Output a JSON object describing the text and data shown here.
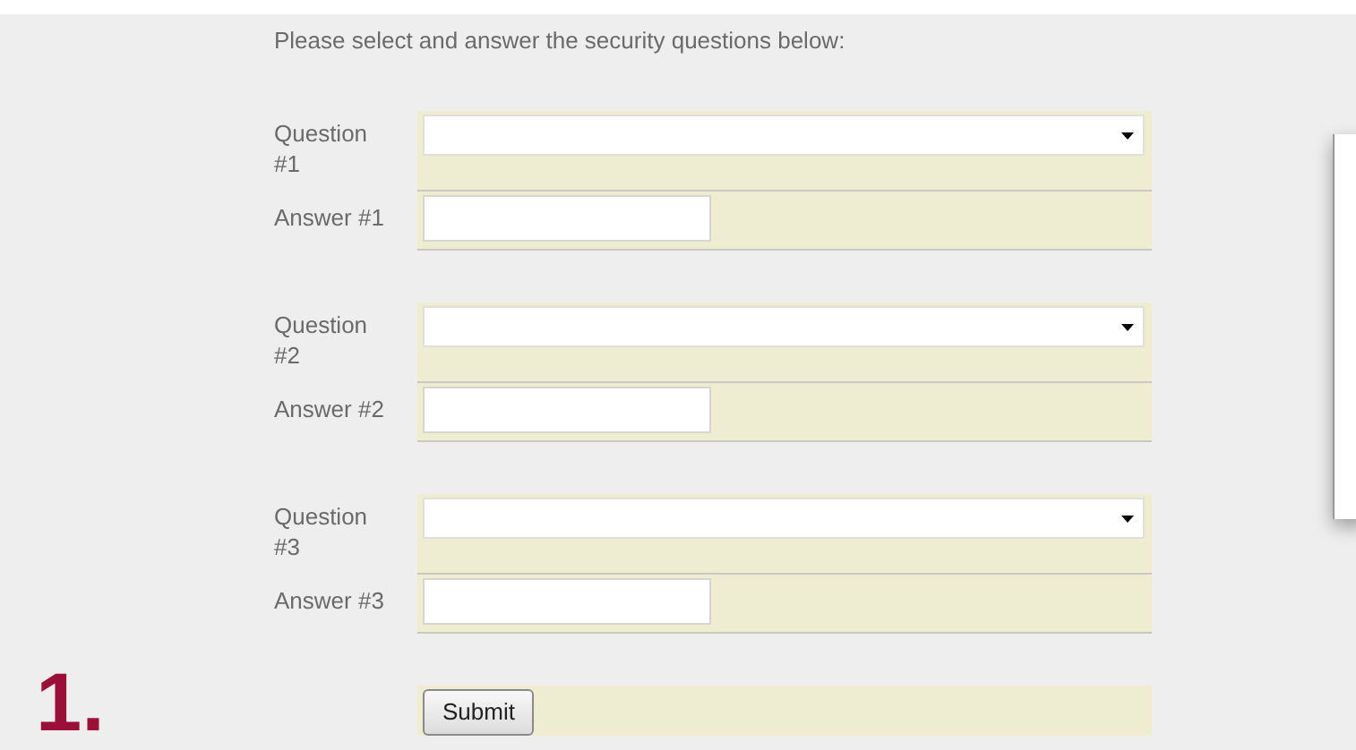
{
  "intro": "Please select and answer the security questions below:",
  "groups": [
    {
      "question_label": "Question #1",
      "answer_label": "Answer #1"
    },
    {
      "question_label": "Question #2",
      "answer_label": "Answer #2"
    },
    {
      "question_label": "Question #3",
      "answer_label": "Answer #3"
    }
  ],
  "submit": "Submit",
  "step": "1."
}
